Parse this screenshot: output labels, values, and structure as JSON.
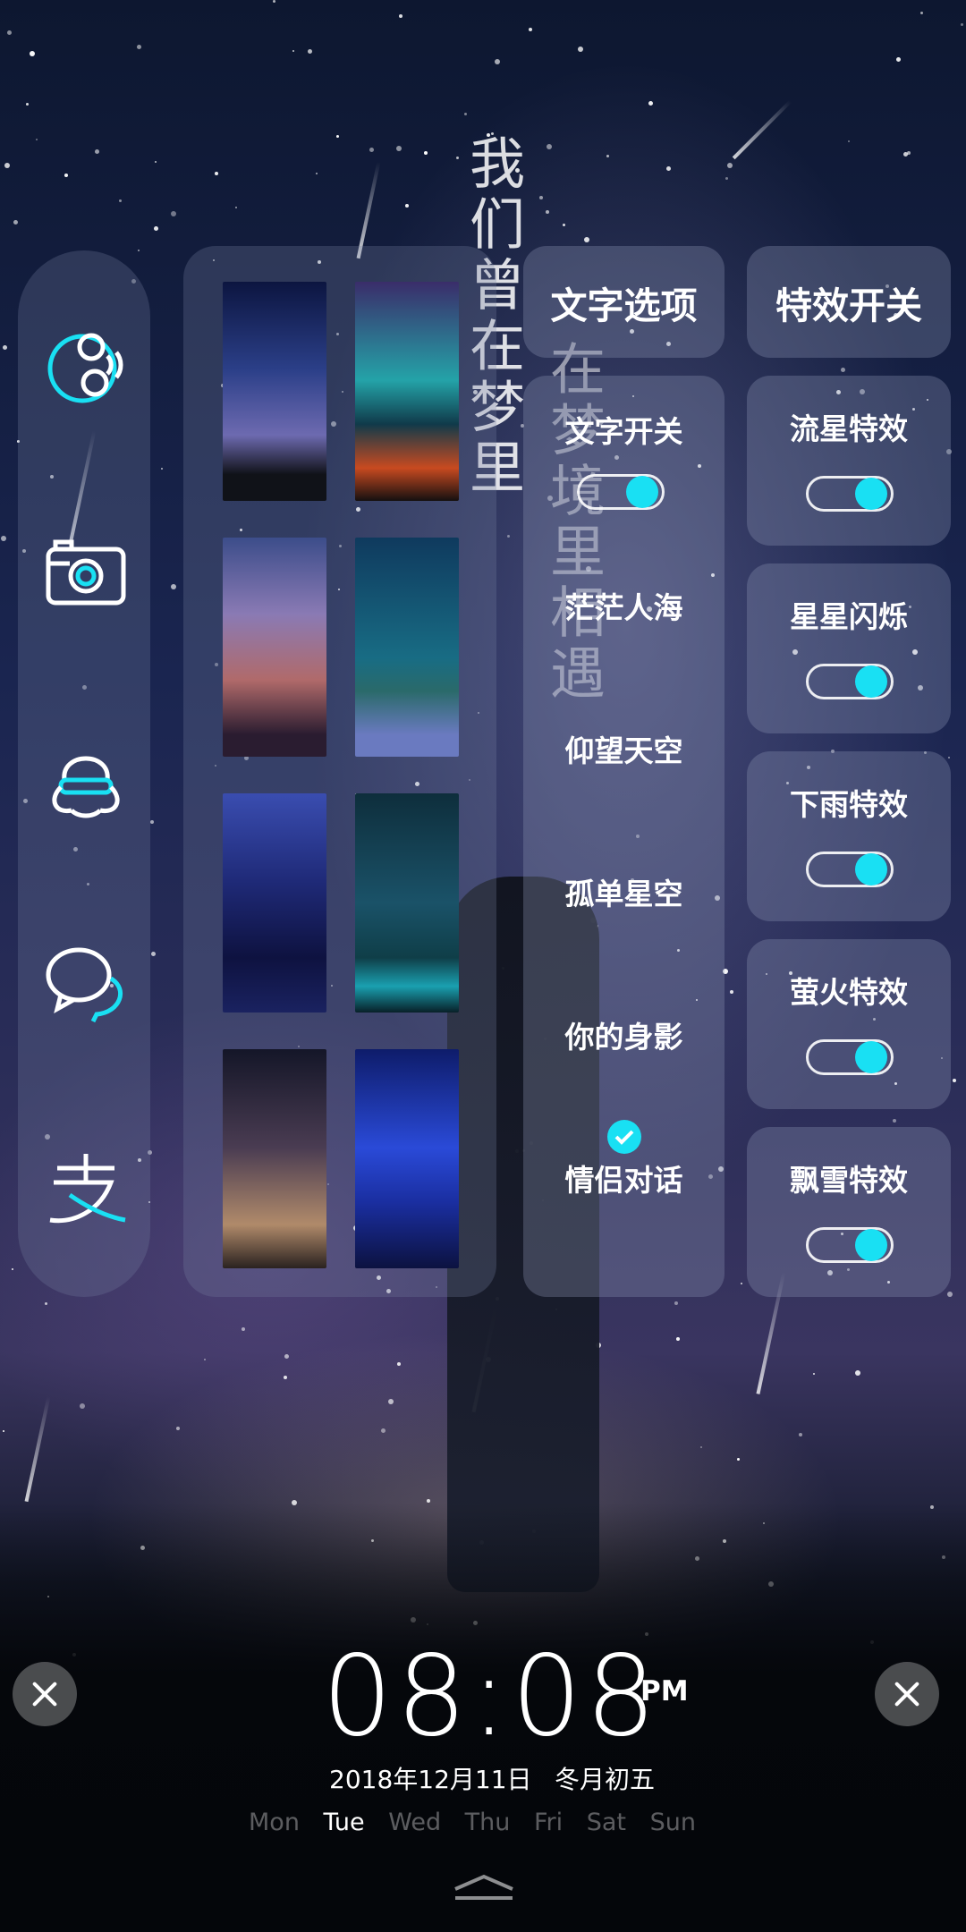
{
  "background_text": [
    "我们曾在梦里",
    "在梦境里相遇"
  ],
  "icons": [
    "moon-phase-icon",
    "camera-icon",
    "qq-penguin-icon",
    "chat-bubbles-icon",
    "alipay-icon"
  ],
  "text_options": {
    "header": "文字选项",
    "switch_label": "文字开关",
    "switch_on": true,
    "items": [
      "茫茫人海",
      "仰望天空",
      "孤单星空",
      "你的身影",
      "情侣对话"
    ],
    "selected_index": 4
  },
  "effects": {
    "header": "特效开关",
    "items": [
      {
        "label": "流星特效",
        "on": true
      },
      {
        "label": "星星闪烁",
        "on": true
      },
      {
        "label": "下雨特效",
        "on": true
      },
      {
        "label": "萤火特效",
        "on": true
      },
      {
        "label": "飘雪特效",
        "on": true
      }
    ]
  },
  "clock": {
    "time": "08:08",
    "ampm": "PM",
    "date": "2018年12月11日",
    "lunar": "冬月初五",
    "weekdays": [
      "Mon",
      "Tue",
      "Wed",
      "Thu",
      "Fri",
      "Sat",
      "Sun"
    ],
    "active_day": "Tue"
  },
  "colors": {
    "accent": "#19e0f3"
  }
}
